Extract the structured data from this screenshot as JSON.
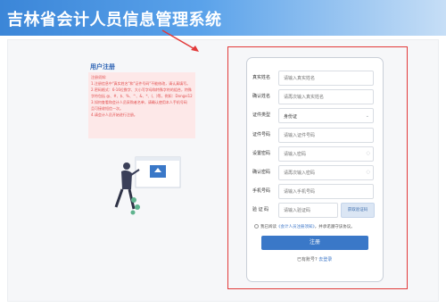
{
  "header": {
    "title": "吉林省会计人员信息管理系统"
  },
  "intro": {
    "title": "用户注册",
    "notice": [
      "注册须知:",
      "1.注册信息中\"真实姓名\"和\"证件号码\"不能修改，请认真填写。",
      "2.密码格式：6-16位数字、大小写字母和特殊字符的组合，特殊",
      "字符包括 @、#、$、%、^、&、*、(、)等，例如：Dongxi123@",
      "3.如何查看和会计人员采购者名单，请确认使用本人手机号码",
      "且可接收短信一次。",
      "4.请会计人员开始进行注册。"
    ]
  },
  "form": {
    "fields": [
      {
        "label": "真实姓名",
        "placeholder": "请输入真实姓名"
      },
      {
        "label": "确认姓名",
        "placeholder": "请再次输入真实姓名"
      },
      {
        "label": "证件类型",
        "value": "身份证",
        "suffix": "⌄"
      },
      {
        "label": "证件号码",
        "placeholder": "请输入证件号码"
      },
      {
        "label": "设置密码",
        "placeholder": "请输入密码",
        "suffix": "◌"
      },
      {
        "label": "确认密码",
        "placeholder": "请再次输入密码",
        "suffix": "◌"
      },
      {
        "label": "手机号码",
        "placeholder": "请输入手机号码"
      },
      {
        "label": "验 证 码",
        "placeholder": "请输入验证码"
      }
    ],
    "code_button": "获取验证码",
    "agree_prefix": "我已阅读",
    "agree_link": "《会计人员注册须知》",
    "agree_suffix": "，并承诺遵守该协议。",
    "submit": "注册",
    "login_prompt": "已有账号?",
    "login_link": "去登录"
  },
  "colors": {
    "header": "#3b86d8",
    "accent": "#3a78c8",
    "highlight": "#e23a3a"
  }
}
